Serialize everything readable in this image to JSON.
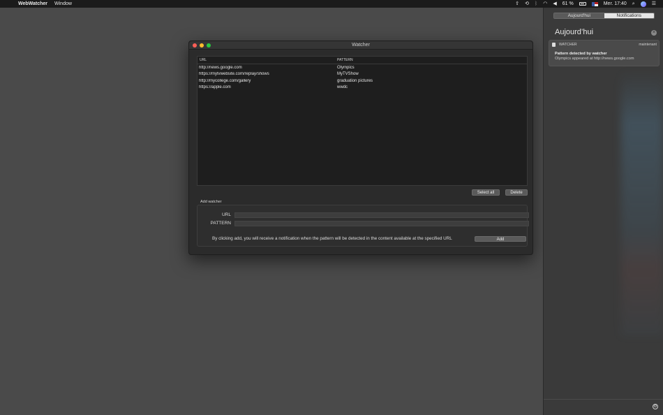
{
  "menubar": {
    "apple_glyph": "",
    "app_name": "WebWatcher",
    "menus": [
      "Window"
    ],
    "battery_pct": "61 %",
    "battery_level": 0.61,
    "clock": "Mer. 17:40"
  },
  "window": {
    "title": "Watcher",
    "table": {
      "columns": [
        "URL",
        "PATTERN"
      ],
      "rows": [
        {
          "url": "http://news.google.com",
          "pattern": "Olympics"
        },
        {
          "url": "https://mytvwebsite.com/replay/shows",
          "pattern": "MyTVShow"
        },
        {
          "url": "http://mycollege.com/gallery",
          "pattern": "graduation pictures"
        },
        {
          "url": "https://apple.com",
          "pattern": "wwdc"
        }
      ]
    },
    "buttons": {
      "select_all": "Select all",
      "delete": "Delete",
      "add": "Add"
    },
    "add_watcher": {
      "section_label": "Add watcher",
      "url_label": "URL",
      "pattern_label": "PATTERN",
      "url_value": "",
      "pattern_value": "",
      "hint": "By clicking add, you will receive a notification when the pattern will be detected in the content available at the specified URL"
    }
  },
  "notification_center": {
    "tabs": [
      {
        "label": "Aujourd'hui",
        "active": false
      },
      {
        "label": "Notifications",
        "active": true
      }
    ],
    "title": "Aujourd’hui",
    "notification": {
      "app": "WATCHER",
      "time": "maintenant",
      "title": "Pattern detected by watcher",
      "body": "Olympics appeared at http://news.google.com"
    }
  },
  "colors": {
    "close": "#ff5f57",
    "minimize": "#febc2e",
    "maximize": "#28c840"
  }
}
